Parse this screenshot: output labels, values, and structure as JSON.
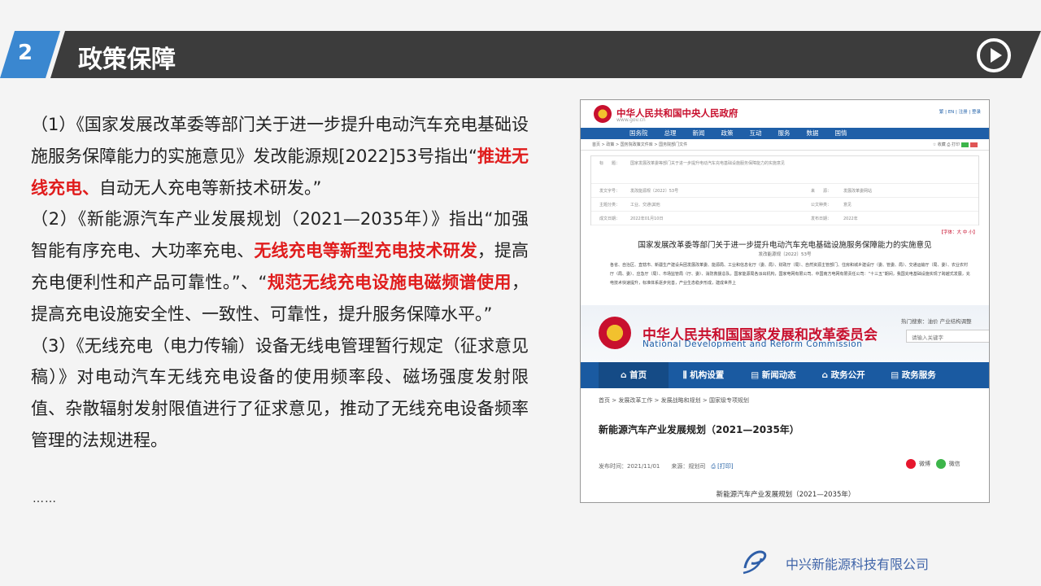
{
  "header": {
    "number": "2",
    "title": "政策保障"
  },
  "paragraphs": [
    [
      {
        "t": "（1）《国家发展改革委等部门关于进一步提升电动汽车充电基础设施服务保障能力的实施意见》发改能源规[2022]53号指出“"
      },
      {
        "t": "推进无线充电、",
        "red": true
      },
      {
        "t": "自动无人充电等新技术研发。”"
      }
    ],
    [
      {
        "t": "（2）《新能源汽车产业发展规划（2021—2035年）》指出“加强智能有序充电、大功率充电、"
      },
      {
        "t": "无线充电等新型充电技术研发",
        "red": true
      },
      {
        "t": "，提高充电便利性和产品可靠性。”、“"
      },
      {
        "t": "规范无线充电设施电磁频谱使用",
        "red": true
      },
      {
        "t": "，提高充电设施安全性、一致性、可靠性，提升服务保障水平。”"
      }
    ],
    [
      {
        "t": "（3）《无线充电（电力传输）设备无线电管理暂行规定（征求意见稿）》对电动汽车无线充电设备的使用频率段、磁场强度发射限值、杂散辐射发射限值进行了征求意见，推动了无线充电设备频率管理的法规进程。"
      }
    ]
  ],
  "ellipsis": "……",
  "screenshot": {
    "gov": {
      "title": "中华人民共和国中央人民政府",
      "domain": "www.gov.cn",
      "top_links": "繁 | EN | 注册 | 登录",
      "nav": [
        "国务院",
        "总理",
        "新闻",
        "政策",
        "互动",
        "服务",
        "数据",
        "国情"
      ],
      "breadcrumb": "首页 > 政策 > 国务院政策文件库 > 国务院部门文件",
      "tools": "☆ 收藏  ⎙ 打印",
      "meta_rows": [
        [
          "标　　题：",
          "国家发展改革委等部门关于进一步提升电动汽车充电基础设施服务保障能力的实施意见",
          "",
          ""
        ],
        [
          "发文字号：",
          "发改能源规〔2022〕53号",
          "来　　源：",
          "发展改革委网站"
        ],
        [
          "主题分类：",
          "工业、交通\\其他",
          "公文种类：",
          "意见"
        ],
        [
          "成文日期：",
          "2022年01月10日",
          "发布日期：",
          "2022年"
        ]
      ],
      "font_size": "【字体：大 中 小】",
      "doc_title": "国家发展改革委等部门关于进一步提升电动汽车充电基础设施服务保障能力的实施意见",
      "doc_no": "发改能源规〔2022〕53号",
      "body": "各省、自治区、直辖市、新疆生产建设兵团发展改革委、能源局、工业和信息化厅（委、局）、财政厅（局）、自然资源主管部门、住房和城乡建设厅（委、管委、局）、交通运输厅（局、委）、农业农村厅（局、委）、应急厅（局）、市场监管局（厅、委）、消防救援总队，国家能源局各派出机构，国家电网有限公司、中国南方电网有限责任公司：“十三五”期间，我国充电基础设施实现了跨越式发展，充电技术快速提升，标准体系逐步完善，产业生态稳步形成，建成世界上"
    },
    "ndrc": {
      "title": "中华人民共和国国家发展和改革委员会",
      "subtitle": "National Development and Reform Commission",
      "hot": "热门搜索：油价  产业结构调整",
      "search_placeholder": "请输入关键字",
      "nav": [
        "⌂ 首页",
        "⫼ 机构设置",
        "▤ 新闻动态",
        "⌂ 政务公开",
        "▤ 政务服务"
      ],
      "breadcrumb": "首页 > 发展改革工作 > 发展战略和规划 > 国家级专项规划",
      "article_title": "新能源汽车产业发展规划（2021—2035年）",
      "publish": "发布时间：2021/11/01　　来源：规划司",
      "print": "⎙ [打印]",
      "share": [
        "微博",
        "微信"
      ],
      "footer": "新能源汽车产业发展规划（2021—2035年）"
    }
  },
  "company": "中兴新能源科技有限公司",
  "colors": {
    "accent_blue": "#3a87d0",
    "header_dark": "#3c3c3c",
    "highlight_red": "#e01c1c"
  }
}
